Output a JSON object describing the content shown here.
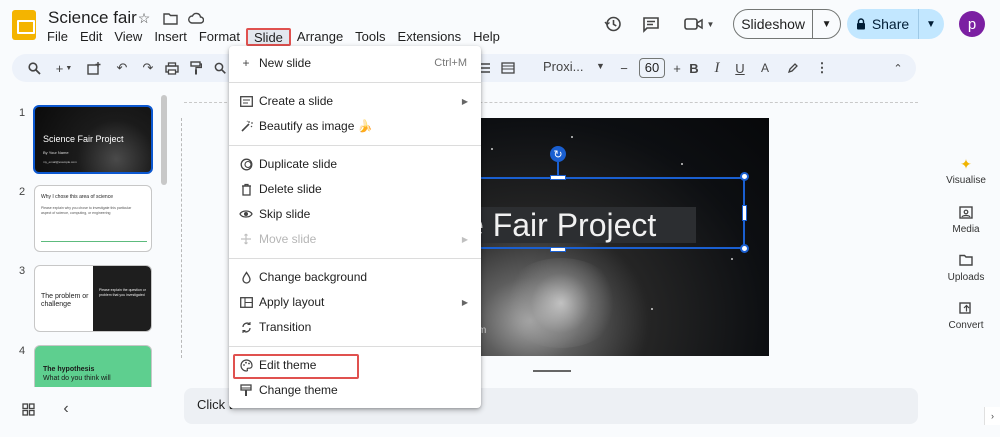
{
  "app": {
    "doc_title": "Science fair",
    "menus": [
      "File",
      "Edit",
      "View",
      "Insert",
      "Format",
      "Slide",
      "Arrange",
      "Tools",
      "Extensions",
      "Help"
    ],
    "active_menu": "Slide",
    "slideshow_label": "Slideshow",
    "share_label": "Share",
    "avatar_letter": "p"
  },
  "toolbar": {
    "font_name": "Proxi...",
    "font_size": "60"
  },
  "filmstrip": {
    "slides": [
      {
        "num": "1",
        "title": "Science Fair Project",
        "sub": "By Your Name",
        "email": "my_email@example.com"
      },
      {
        "num": "2",
        "title": "Why I chose this area of science",
        "body": "Please explain why you chose to investigate this particular aspect of science, computing, or engineering"
      },
      {
        "num": "3",
        "title": "The problem or challenge",
        "body": "Please explain the question or problem that you investigated"
      },
      {
        "num": "4",
        "title": "The hypothesis",
        "body": "What do you think will"
      }
    ]
  },
  "canvas": {
    "title_visible": "e Fair Project",
    "subtext": "m",
    "notes_placeholder": "Click t"
  },
  "side_panel": {
    "items": [
      "Visualise",
      "Media",
      "Uploads",
      "Convert"
    ]
  },
  "slide_menu": {
    "new_slide": {
      "label": "New slide",
      "shortcut": "Ctrl+M"
    },
    "create_slide": "Create a slide",
    "beautify": "Beautify as image 🍌",
    "duplicate": "Duplicate slide",
    "delete": "Delete slide",
    "skip": "Skip slide",
    "move": "Move slide",
    "change_background": "Change background",
    "apply_layout": "Apply layout",
    "transition": "Transition",
    "edit_theme": "Edit theme",
    "change_theme": "Change theme"
  },
  "colors": {
    "accent_blue": "#0b57d0",
    "highlight_red": "#e0514f",
    "share_bg": "#c2e7ff",
    "logo_yellow": "#f4b400"
  }
}
